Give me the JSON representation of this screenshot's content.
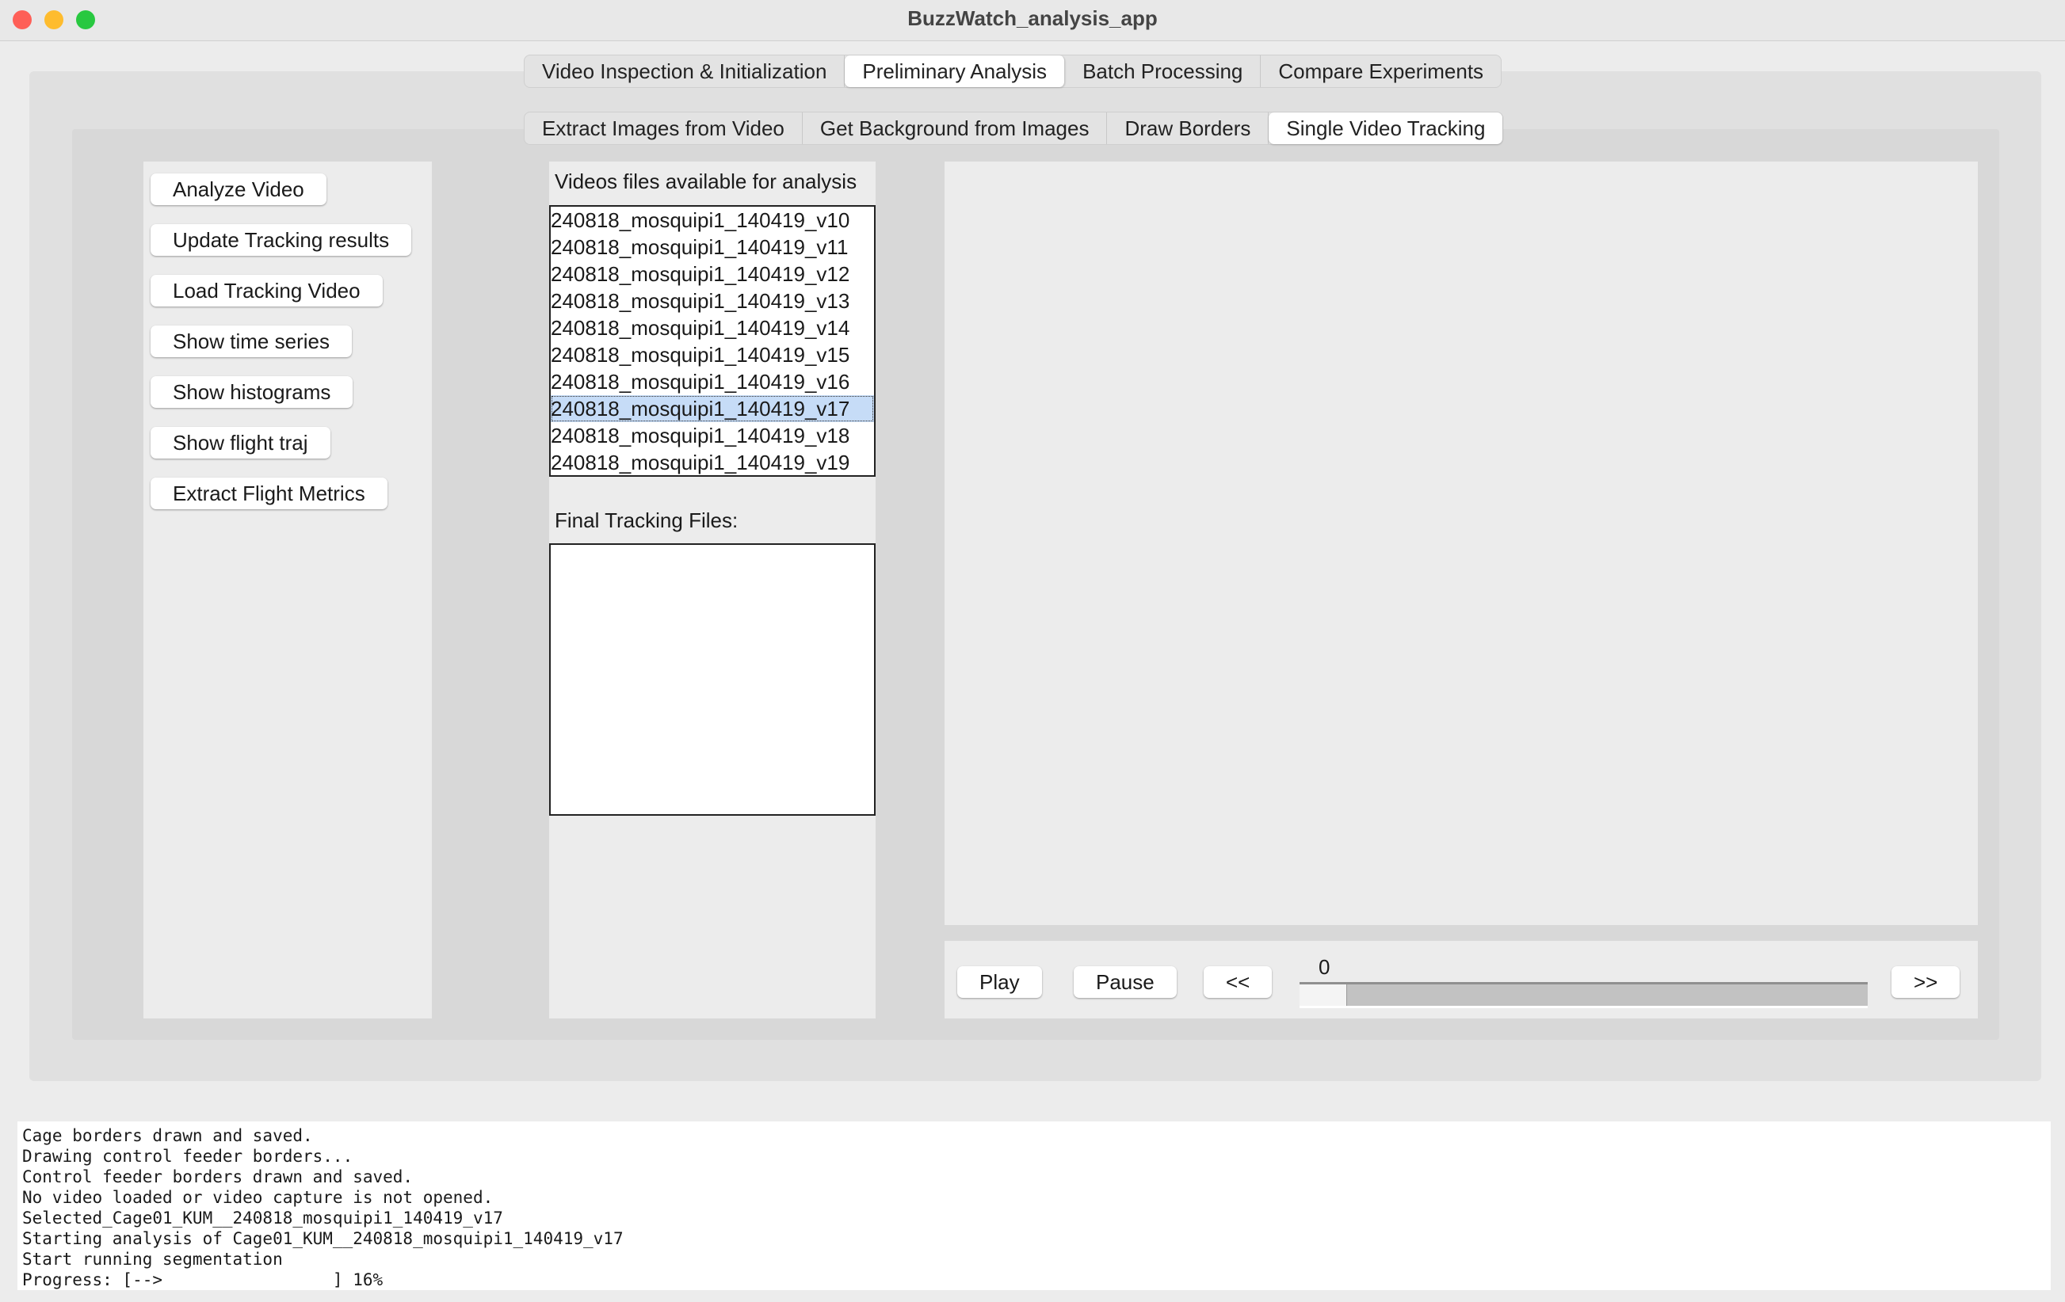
{
  "window": {
    "title": "BuzzWatch_analysis_app",
    "traffic_lights": {
      "close": "#fe5f57",
      "minimize": "#febc2e",
      "zoom": "#28c840"
    }
  },
  "main_tabs": [
    {
      "label": "Video Inspection & Initialization",
      "selected": false
    },
    {
      "label": "Preliminary Analysis",
      "selected": true
    },
    {
      "label": "Batch Processing",
      "selected": false
    },
    {
      "label": "Compare Experiments",
      "selected": false
    }
  ],
  "sub_tabs": [
    {
      "label": "Extract Images from Video",
      "selected": false
    },
    {
      "label": "Get Background from Images",
      "selected": false
    },
    {
      "label": "Draw Borders",
      "selected": false
    },
    {
      "label": "Single Video Tracking",
      "selected": true
    }
  ],
  "actions": [
    {
      "label": "Analyze Video"
    },
    {
      "label": "Update Tracking results"
    },
    {
      "label": "Load Tracking Video"
    },
    {
      "label": "Show time series"
    },
    {
      "label": "Show histograms"
    },
    {
      "label": "Show flight traj"
    },
    {
      "label": "Extract Flight Metrics"
    }
  ],
  "videos": {
    "label": "Videos files available for analysis",
    "items": [
      "240818_mosquipi1_140419_v10",
      "240818_mosquipi1_140419_v11",
      "240818_mosquipi1_140419_v12",
      "240818_mosquipi1_140419_v13",
      "240818_mosquipi1_140419_v14",
      "240818_mosquipi1_140419_v15",
      "240818_mosquipi1_140419_v16",
      "240818_mosquipi1_140419_v17",
      "240818_mosquipi1_140419_v18",
      "240818_mosquipi1_140419_v19"
    ],
    "selected_index": 7
  },
  "tracking_files": {
    "label": "Final Tracking Files:",
    "items": []
  },
  "player": {
    "play": "Play",
    "pause": "Pause",
    "prev": "<<",
    "next": ">>",
    "frame_value": "0",
    "slider_fraction": 0
  },
  "log": {
    "lines": [
      "Cage borders drawn and saved.",
      "Drawing control feeder borders...",
      "Control feeder borders drawn and saved.",
      "No video loaded or video capture is not opened.",
      "Selected_Cage01_KUM__240818_mosquipi1_140419_v17",
      "Starting analysis of Cage01_KUM__240818_mosquipi1_140419_v17",
      "Start running segmentation",
      "Progress: [-->                 ] 16%"
    ],
    "progress_percent": 16
  }
}
